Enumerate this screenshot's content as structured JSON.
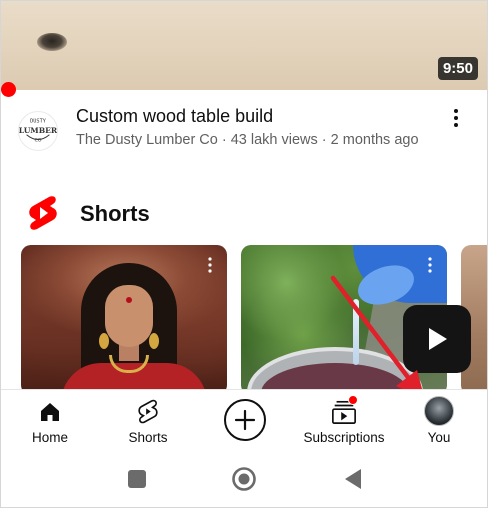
{
  "video": {
    "duration": "9:50",
    "title": "Custom wood table build",
    "channel": "The Dusty Lumber Co",
    "views": "43 lakh views",
    "age": "2 months ago",
    "meta_line": "The Dusty Lumber Co · 43 lakh views · 2 months ago",
    "channel_logo_text_top": "DUSTY",
    "channel_logo_text_mid": "LUMBER",
    "channel_logo_text_bot": "CO"
  },
  "shorts_section": {
    "heading": "Shorts",
    "brand_color": "#ff0000"
  },
  "bottom_nav": {
    "items": [
      {
        "label": "Home",
        "icon": "home-icon"
      },
      {
        "label": "Shorts",
        "icon": "shorts-icon"
      },
      {
        "label": "",
        "icon": "create-plus-icon"
      },
      {
        "label": "Subscriptions",
        "icon": "subscriptions-icon"
      },
      {
        "label": "You",
        "icon": "avatar"
      }
    ]
  },
  "colors": {
    "accent_red": "#ff0000",
    "annotation_arrow": "#e0202a"
  }
}
